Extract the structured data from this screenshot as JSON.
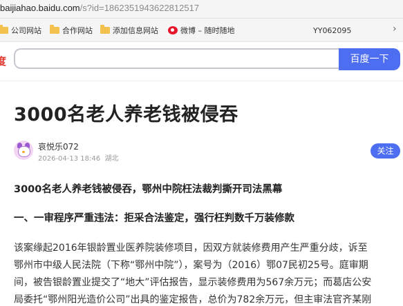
{
  "browser": {
    "url_host": "baijiahao.baidu.com",
    "url_query": "/s?id=1862351943622812517"
  },
  "bookmarks": {
    "items": [
      {
        "label": "公司网站",
        "icon": "folder-icon"
      },
      {
        "label": "合作网站",
        "icon": "folder-icon"
      },
      {
        "label": "添加信息网站",
        "icon": "folder-icon"
      },
      {
        "label": "微博 – 随时随地",
        "icon": "weibo-icon"
      },
      {
        "label": "YY062095",
        "icon": ""
      }
    ],
    "more_glyph": "›"
  },
  "search": {
    "logo_fragment": "度",
    "placeholder": "",
    "button_label": "百度一下",
    "accent_color": "#4e6ef2"
  },
  "article": {
    "title": "3000名老人养老钱被侵吞",
    "author": "哀悦乐072",
    "date": "2026-04-13 18:46",
    "location": "湖北",
    "follow_label": "关注",
    "lead": "3000名老人养老钱被侵吞，鄂州中院枉法裁判撕开司法黑幕",
    "heading_1": "一、一审程序严重违法：拒采合法鉴定，强行枉判数千万装修款",
    "paragraph_lines": [
      "该案缘起2016年银龄置业医养院装修项目，因双方就装修费用产生严重分歧，诉至",
      "鄂州市中级人民法院（下称“鄂州中院”），案号为（2016）鄂07民初25号。庭审期",
      "间，被告银龄置业提交了“地大”评估报告，显示装修费用为567余万元；而葛店公安",
      "局委托“鄂州阳光造价公司”出具的鉴定报告，总价为782余万元，但主审法官齐某刚"
    ]
  }
}
